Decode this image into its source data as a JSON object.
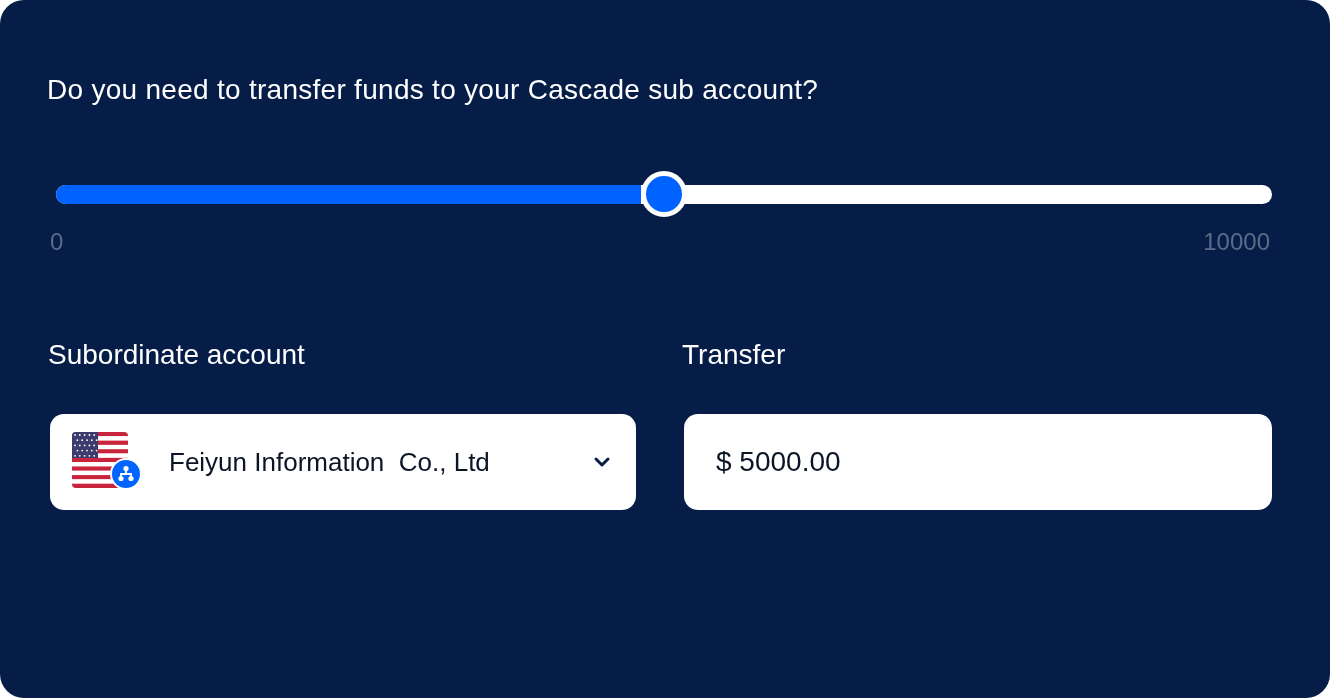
{
  "question": "Do you need to transfer funds to your Cascade sub account?",
  "slider": {
    "level": 0.5,
    "min_label": "0",
    "max_label": "10000"
  },
  "subordinate_account": {
    "label": "Subordinate account",
    "value": "Feiyun Information  Co., Ltd"
  },
  "transfer": {
    "label": "Transfer",
    "value": "$ 5000.00"
  }
}
